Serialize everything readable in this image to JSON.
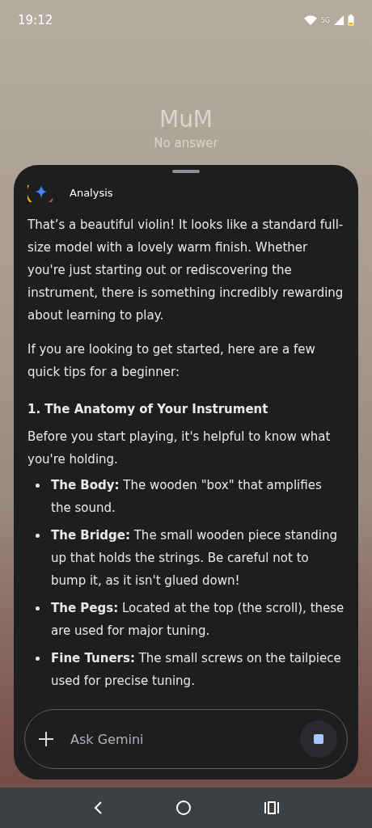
{
  "status_bar": {
    "time": "19:12",
    "network": "5G"
  },
  "call": {
    "name": "MuM",
    "status": "No answer"
  },
  "sheet": {
    "title": "Analysis",
    "paragraphs": [
      "That’s a beautiful violin! It looks like a standard full-size model with a lovely warm finish. Whether you're just starting out or rediscovering the instrument, there is something incredibly rewarding about learning to play.",
      "If you are looking to get started, here are a few quick tips for a beginner:"
    ],
    "heading": "1. The Anatomy of Your Instrument",
    "intro": "Before you start playing, it's helpful to know what you're holding.",
    "bullets": [
      "**The Body:** The wooden \"box\" that amplifies the sound.",
      "**The Bridge:** The small wooden piece standing up that holds the strings. Be careful not to bump it, as it isn't glued down!",
      "**The Pegs:** Located at the top (the scroll), these are used for major tuning.",
      "**Fine Tuners:** The small screws on the tailpiece used for precise tuning."
    ]
  },
  "input": {
    "placeholder": "Ask Gemini"
  }
}
